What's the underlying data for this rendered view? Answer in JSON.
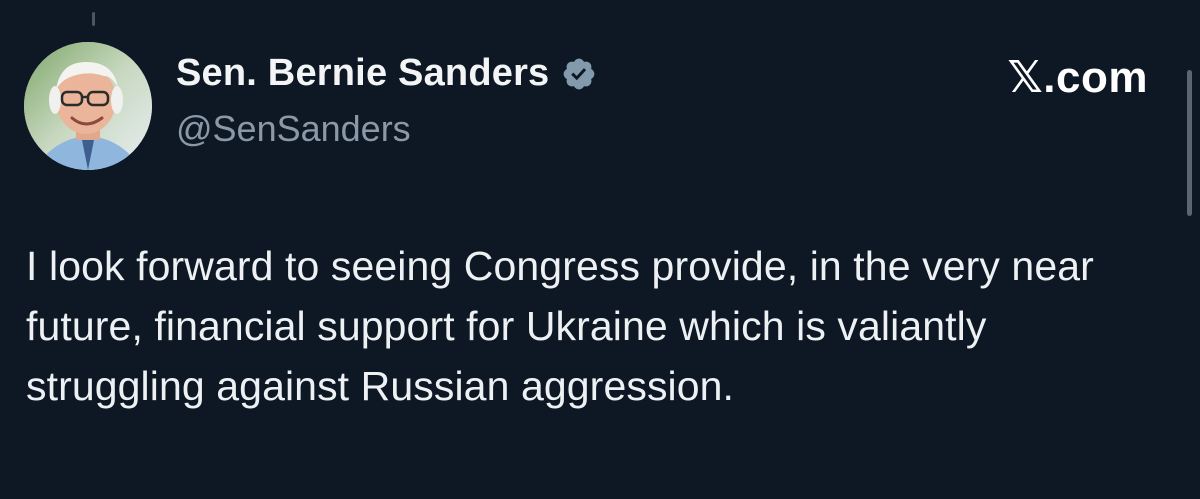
{
  "author": {
    "display_name": "Sen. Bernie Sanders",
    "handle": "@SenSanders",
    "verified": true,
    "verified_badge_color": "#829aab",
    "avatar_icon": "profile-photo"
  },
  "brand": {
    "label": "𝕏.com"
  },
  "tweet": {
    "text": "I look forward to seeing Congress provide, in the very near future, financial support for Ukraine which is valiantly struggling against Russian aggression."
  },
  "colors": {
    "background": "#0e1824",
    "text_primary": "#eef1f3",
    "text_secondary": "#8b98a5"
  }
}
